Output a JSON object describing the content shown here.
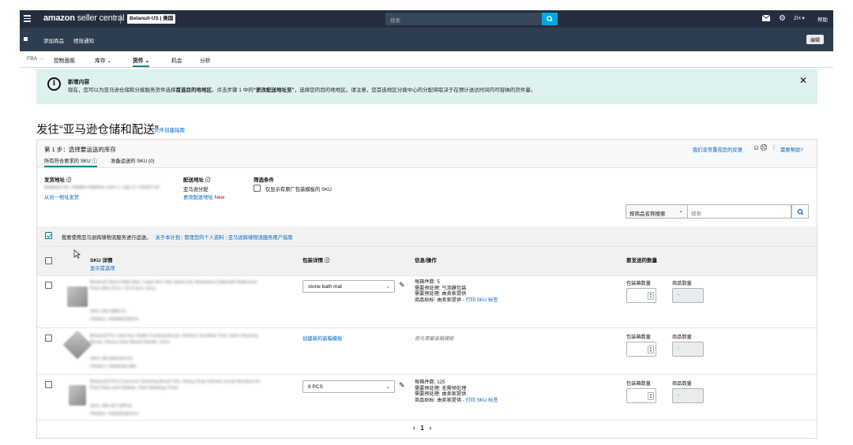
{
  "header": {
    "logo_brand": "amazon",
    "logo_text": "seller central",
    "store": "Betanull-US | 美国",
    "search_placeholder": "搜索",
    "lang": "ZH ▾",
    "help": "帮助",
    "colors": {
      "bar": "#232f3e",
      "subbar": "#2d3e50",
      "search_button": "#00a8e1",
      "accent": "#008296"
    }
  },
  "subheader": {
    "links": [
      "添加商品",
      "绩效通知"
    ],
    "edit": "编辑"
  },
  "nav": {
    "items": [
      "FBA →",
      "控制面板",
      "库存 ⌄",
      "货件 ⌄",
      "机会",
      "分析"
    ],
    "active_index": 3
  },
  "notice": {
    "title": "新增内容",
    "body_pre": "现在，您可以为亚马逊仓储和分拨服务货件选择",
    "body_bold1": "首选目的地地区",
    "body_mid": "。点击步骤 1 中的",
    "body_bold2": "“更改配送地址至”",
    "body_post": "，选择您的目的地地区。请注意，您首选地区分拨中心的分配将取决于在预计送达时间内可容纳的货件量。",
    "close": "✕"
  },
  "page": {
    "title": "发往“亚马逊仓储和配送”",
    "guide_link": "货件创建指南"
  },
  "step": {
    "title": "第 1 步：选择要运送的库存",
    "feedback": "我们非常重视您的反馈",
    "feedback_faces": "☺☹",
    "need_help": "需要帮助?",
    "tab_eligible": "所有符合要求的 SKU ⓘ",
    "tab_ready": "准备运送的 SKU (0)",
    "ship_from_label": "发货地址 ⓘ",
    "ship_from_value": "Betanull Inc, Hidden Address Line 1, City ST 00000 US",
    "ship_from_link": "从另一地址发货",
    "ship_to_label": "配送地址 ⓘ",
    "ship_to_value": "亚马逊分配",
    "ship_to_link": "更改配送地址",
    "ship_to_new": "New",
    "filter_label": "筛选条件",
    "filter_option": "仅显示有原厂包装模板的 SKU",
    "search_select": "按商品名称搜索",
    "search_select_chev": "⌄",
    "search_placeholder": "搜索",
    "agree_text": "我要使用亚马逊跨境物流服务进行运送。",
    "agree_links": [
      "关于本计划",
      "管理您的个人资料",
      "亚马逊跨境物流服务用户指南"
    ]
  },
  "table": {
    "headers": {
      "sku": "SKU 详情",
      "sku_sub": "显示首选项",
      "pack": "包装详情 ⓘ",
      "info": "信息/操作",
      "qty": "要发送的数量"
    },
    "qty_labels": {
      "boxes": "包装箱数量",
      "units": "商品数量"
    },
    "rows": [
      {
        "title": "Betanull Stone Bath Mat, Large Non Slip Quick Dry Absorbent Diatomite Bathroom Floor Mat 23.6 x 15.4 Inch, Grey",
        "sku": "SKU: BN-SBM-01",
        "fnsku": "FNSKU: X00ABCDEFG",
        "pack": "stone bath mat",
        "info": [
          "每箱件数: 5",
          "需要预处理: 气泡膜包装",
          "需要预处理: 由卖家提供"
        ],
        "label_prefix": "商品贴标: 由卖家提供 - ",
        "label_link": "打印 SKU 标签",
        "units": "-"
      },
      {
        "title": "Betanull Pro Cast Iron Skillet Cooking Brush, Kitchen Scrubber Tool, Dish Cleaning Brush, Heavy Duty Wood Handle, Grey",
        "sku": "SKU: BN-BRUSH-02",
        "fnsku": "FNSKU: X00HIJKLMN",
        "pack_link": "创建新的装箱模板",
        "info_placeholder": "首先需要装箱模板",
        "units": "-"
      },
      {
        "title": "Betanull 8 Pcs Cast Iron Cleaning Brush Set, Heavy Duty Kitchen Scrub Brushes for Pots Pans and Skillets, Dish Washing Tools",
        "sku": "SKU: BN-SET-8PCS",
        "fnsku": "FNSKU: X00OPQRSTU",
        "pack": "8 PCS",
        "info": [
          "每箱件数: 125",
          "需要预处理: 无需预处理",
          "需要预处理: 由卖家提供"
        ],
        "label_prefix": "商品贴标: 由卖家提供 - ",
        "label_link": "打印 SKU 标签",
        "units": "-"
      }
    ],
    "pagination": {
      "prev": "‹",
      "page": "1",
      "next": "›"
    }
  }
}
